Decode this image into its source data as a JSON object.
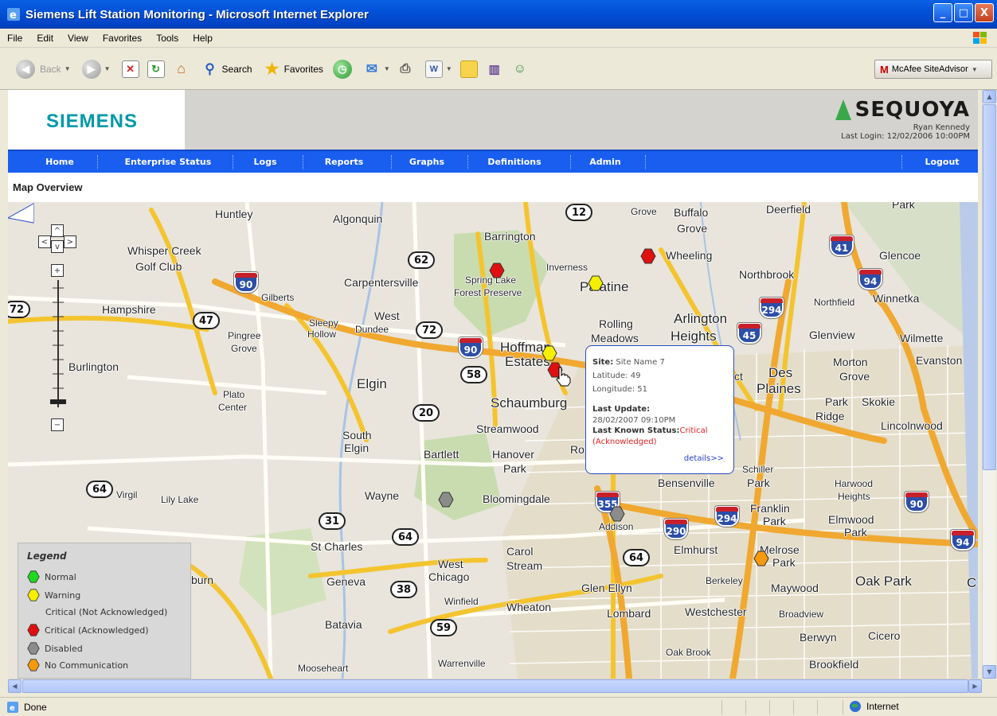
{
  "window": {
    "title": "Siemens Lift Station Monitoring - Microsoft Internet Explorer",
    "buttons": [
      "_",
      "□",
      "X"
    ]
  },
  "menubar": [
    "File",
    "Edit",
    "View",
    "Favorites",
    "Tools",
    "Help"
  ],
  "toolbar": {
    "back_label": "Back",
    "search_label": "Search",
    "favorites_label": "Favorites",
    "mcafee_label": "McAfee SiteAdvisor"
  },
  "statusbar": {
    "status_text": "Done",
    "zone_text": "Internet"
  },
  "page": {
    "brand_left": "SIEMENS",
    "brand_right": "SEQUOYA",
    "user": "Ryan Kennedy",
    "last_login": "Last Login: 12/02/2006 10:00PM",
    "nav": [
      "Home",
      "Enterprise Status",
      "Logs",
      "Reports",
      "Graphs",
      "Definitions",
      "Admin",
      "Logout"
    ],
    "section_title": "Map Overview"
  },
  "map": {
    "zoom_buttons": {
      "left": "<",
      "up": "^",
      "right": ">",
      "down": "v",
      "plus": "+",
      "minus": "−"
    },
    "places": [
      "Huntley",
      "Algonquin",
      "Barrington",
      "Grove",
      "Buffalo",
      "Grove",
      "Deerfield",
      "Park",
      "Whisper Creek",
      "Golf Club",
      "Inverness",
      "Wheeling",
      "Glencoe",
      "Carpentersville",
      "Spring Lake",
      "Forest Preserve",
      "Palatine",
      "Northbrook",
      "Gilberts",
      "Hampshire",
      "West",
      "Dundee",
      "Sleepy",
      "Hollow",
      "Rolling",
      "Meadows",
      "Arlington",
      "Heights",
      "Northfield",
      "Winnetka",
      "Pingree",
      "Grove",
      "Hoffman",
      "Estates",
      "Glenview",
      "Wilmette",
      "Burlington",
      "Elgin",
      "Des",
      "Plaines",
      "Morton",
      "Grove",
      "Evanston",
      "Plato",
      "Center",
      "Schaumburg",
      "Park",
      "Ridge",
      "Skokie",
      "South",
      "Elgin",
      "Streamwood",
      "Lincolnwood",
      "Bartlett",
      "Hanover",
      "Park",
      "Ro",
      "Bensenville",
      "Schiller",
      "Park",
      "Harwood",
      "Heights",
      "Virgil",
      "Lily Lake",
      "Wayne",
      "Bloomingdale",
      "Addison",
      "Franklin",
      "Park",
      "Elmwood",
      "Park",
      "St Charles",
      "Carol",
      "Stream",
      "Elmhurst",
      "Melrose",
      "Park",
      "Geneva",
      "West",
      "Chicago",
      "Glen Ellyn",
      "Berkeley",
      "Maywood",
      "Oak Park",
      "Winfield",
      "Wheaton",
      "Lombard",
      "Westchester",
      "Broadview",
      "Batavia",
      "Berwyn",
      "Cicero",
      "Oak Brook",
      "Brookfield",
      "Mooseheart",
      "Warrenville",
      "burn",
      "ct",
      "C"
    ],
    "route_shields": [
      "12",
      "62",
      "47",
      "72",
      "72",
      "58",
      "20",
      "64",
      "31",
      "64",
      "38",
      "59",
      "64"
    ],
    "interstates": [
      "90",
      "90",
      "94",
      "294",
      "41",
      "45",
      "90",
      "355",
      "290",
      "294",
      "90",
      "94"
    ]
  },
  "legend": {
    "title": "Legend",
    "items": [
      {
        "label": "Normal",
        "color": "#1fd91f"
      },
      {
        "label": "Warning",
        "color": "#f5f000"
      },
      {
        "label": "Critical (Not Acknowledged)",
        "color": null
      },
      {
        "label": "Critical (Acknowledged)",
        "color": "#e01010"
      },
      {
        "label": "Disabled",
        "color": "#8c8c8c"
      },
      {
        "label": "No Communication",
        "color": "#f59a0c"
      }
    ]
  },
  "markers": [
    {
      "status": "Critical",
      "color": "#e01010"
    },
    {
      "status": "Critical",
      "color": "#e01010"
    },
    {
      "status": "Warning",
      "color": "#f5f000"
    },
    {
      "status": "Warning",
      "color": "#f5f000"
    },
    {
      "status": "Critical",
      "color": "#e01010"
    },
    {
      "status": "Disabled",
      "color": "#8c8c8c"
    },
    {
      "status": "Disabled",
      "color": "#8c8c8c"
    },
    {
      "status": "No Communication",
      "color": "#f59a0c"
    }
  ],
  "popup": {
    "site_label": "Site:",
    "site_value": "Site Name 7",
    "latitude": "Latitude: 49",
    "longitude": "Longitude: 51",
    "last_update_label": "Last Update:",
    "last_update_value": "28/02/2007 09:10PM",
    "status_label": "Last Known Status:",
    "status_value": "Critical",
    "status_detail": "(Acknowledged)",
    "details_link": "details>>"
  }
}
